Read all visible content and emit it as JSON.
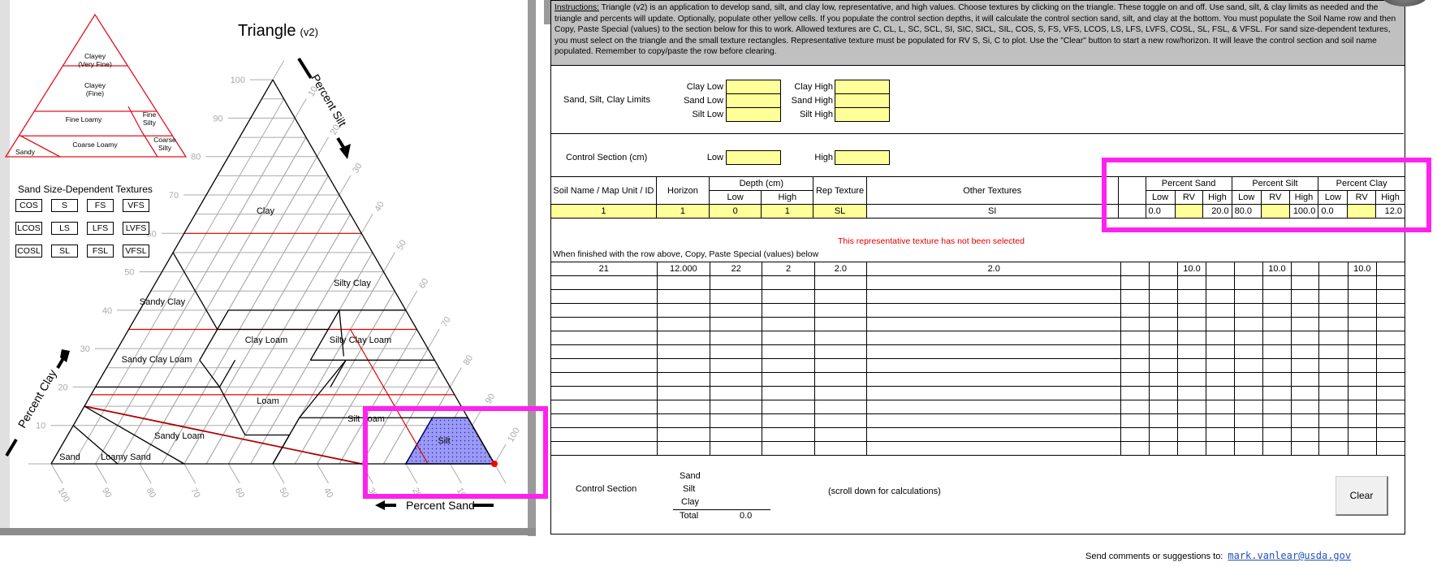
{
  "triangle": {
    "title": "Triangle",
    "version": "(v2)",
    "axis_labels": {
      "silt": "Percent Silt",
      "clay": "Percent Clay",
      "sand": "Percent Sand"
    },
    "clay_ticks": [
      "100",
      "90",
      "80",
      "70",
      "60",
      "50",
      "40",
      "30",
      "20",
      "10"
    ],
    "silt_ticks": [
      "10",
      "20",
      "30",
      "40",
      "50",
      "60",
      "70",
      "80",
      "90",
      "100"
    ],
    "sand_ticks": [
      "100",
      "90",
      "80",
      "70",
      "60",
      "50",
      "40",
      "30",
      "20",
      "10"
    ],
    "textures": [
      "Clay",
      "Silty Clay",
      "Sandy Clay",
      "Clay Loam",
      "Silty Clay Loam",
      "Sandy Clay Loam",
      "Loam",
      "Silt Loam",
      "Sandy Loam",
      "Silt",
      "Sand",
      "Loamy Sand"
    ],
    "selected_texture": "Silt",
    "selected_color": "#9999ff",
    "rep_point": {
      "sand": 0,
      "silt": 100,
      "clay": 0
    }
  },
  "family_triangle": {
    "classes": [
      "Clayey (Very Fine)",
      "Clayey (Fine)",
      "Fine Loamy",
      "Fine Silty",
      "Coarse Loamy",
      "Coarse Silty",
      "Sandy"
    ]
  },
  "sand_dependent": {
    "title": "Sand Size-Dependent Textures",
    "buttons": [
      "COS",
      "S",
      "FS",
      "VFS",
      "LCOS",
      "LS",
      "LFS",
      "LVFS",
      "COSL",
      "SL",
      "FSL",
      "VFSL"
    ]
  },
  "instructions": {
    "label": "Instructions:",
    "text": " Triangle (v2) is an application to develop sand, silt, and clay low, representative, and high values. Choose textures by clicking on the triangle. These toggle on and off. Use sand, silt, & clay limits as needed and the triangle and percents will update. Optionally, populate other yellow cells. If you populate the control section depths, it will calculate the control section sand, silt, and clay at the bottom. You must populate the Soil Name row and then Copy, Paste Special (values) to the section below for this to work. Allowed textures are C, CL, L, SC, SCL, SI, SIC, SICL, SIL, COS, S, FS, VFS, LCOS, LS, LFS, LVFS, COSL, SL, FSL, & VFSL. For sand size-dependent textures, you must select on the triangle and the small texture rectangles. Representative texture must be populated for RV S, Si, C to plot. Use the \"Clear\" button to start a new row/horizon. It will leave the control section and soil name populated. Remember to copy/paste the row before clearing."
  },
  "limits": {
    "section_label": "Sand, Silt, Clay Limits",
    "clay_low": "Clay Low",
    "sand_low": "Sand Low",
    "silt_low": "Silt Low",
    "clay_high": "Clay High",
    "sand_high": "Sand High",
    "silt_high": "Silt High",
    "values": {
      "clay_low": "",
      "sand_low": "",
      "silt_low": "",
      "clay_high": "",
      "sand_high": "",
      "silt_high": ""
    }
  },
  "control_section": {
    "label": "Control Section (cm)",
    "low_label": "Low",
    "high_label": "High",
    "low": "",
    "high": ""
  },
  "table": {
    "headers": {
      "soil_name": "Soil Name / Map Unit / ID",
      "horizon": "Horizon",
      "depth": "Depth (cm)",
      "low": "Low",
      "high": "High",
      "rv": "RV",
      "rep_texture": "Rep Texture",
      "other_textures": "Other Textures",
      "pct_sand": "Percent Sand",
      "pct_silt": "Percent Silt",
      "pct_clay": "Percent Clay"
    },
    "input_row": {
      "soil_name": "1",
      "horizon": "1",
      "depth_low": "0",
      "depth_high": "1",
      "rep_texture": "SL",
      "other_textures": "SI",
      "sand_low": "0.0",
      "sand_rv": "",
      "sand_high": "20.0",
      "silt_low": "80.0",
      "silt_rv": "",
      "silt_high": "100.0",
      "clay_low": "0.0",
      "clay_rv": "",
      "clay_high": "12.0"
    },
    "warning": "This representative texture has not been selected",
    "paste_note": "When finished with the row above, Copy, Paste Special (values) below",
    "pasted_rows": [
      [
        "21",
        "12.000",
        "22",
        "2",
        "2.0",
        "2.0",
        "",
        "10.0",
        "",
        "",
        "10.0",
        "",
        "",
        "10.0",
        ""
      ]
    ]
  },
  "control_summary": {
    "label": "Control Section",
    "sand": "Sand",
    "silt": "Silt",
    "clay": "Clay",
    "total_label": "Total",
    "total": "0.0",
    "scroll_note": "(scroll down for calculations)"
  },
  "clear_button": "Clear",
  "footer": {
    "text": "Send comments or suggestions to:",
    "email": "mark.vanlear@usda.gov"
  },
  "colors": {
    "highlight": "#ff22ee",
    "yellow_cell": "#ffff99",
    "warning": "#e00000"
  }
}
